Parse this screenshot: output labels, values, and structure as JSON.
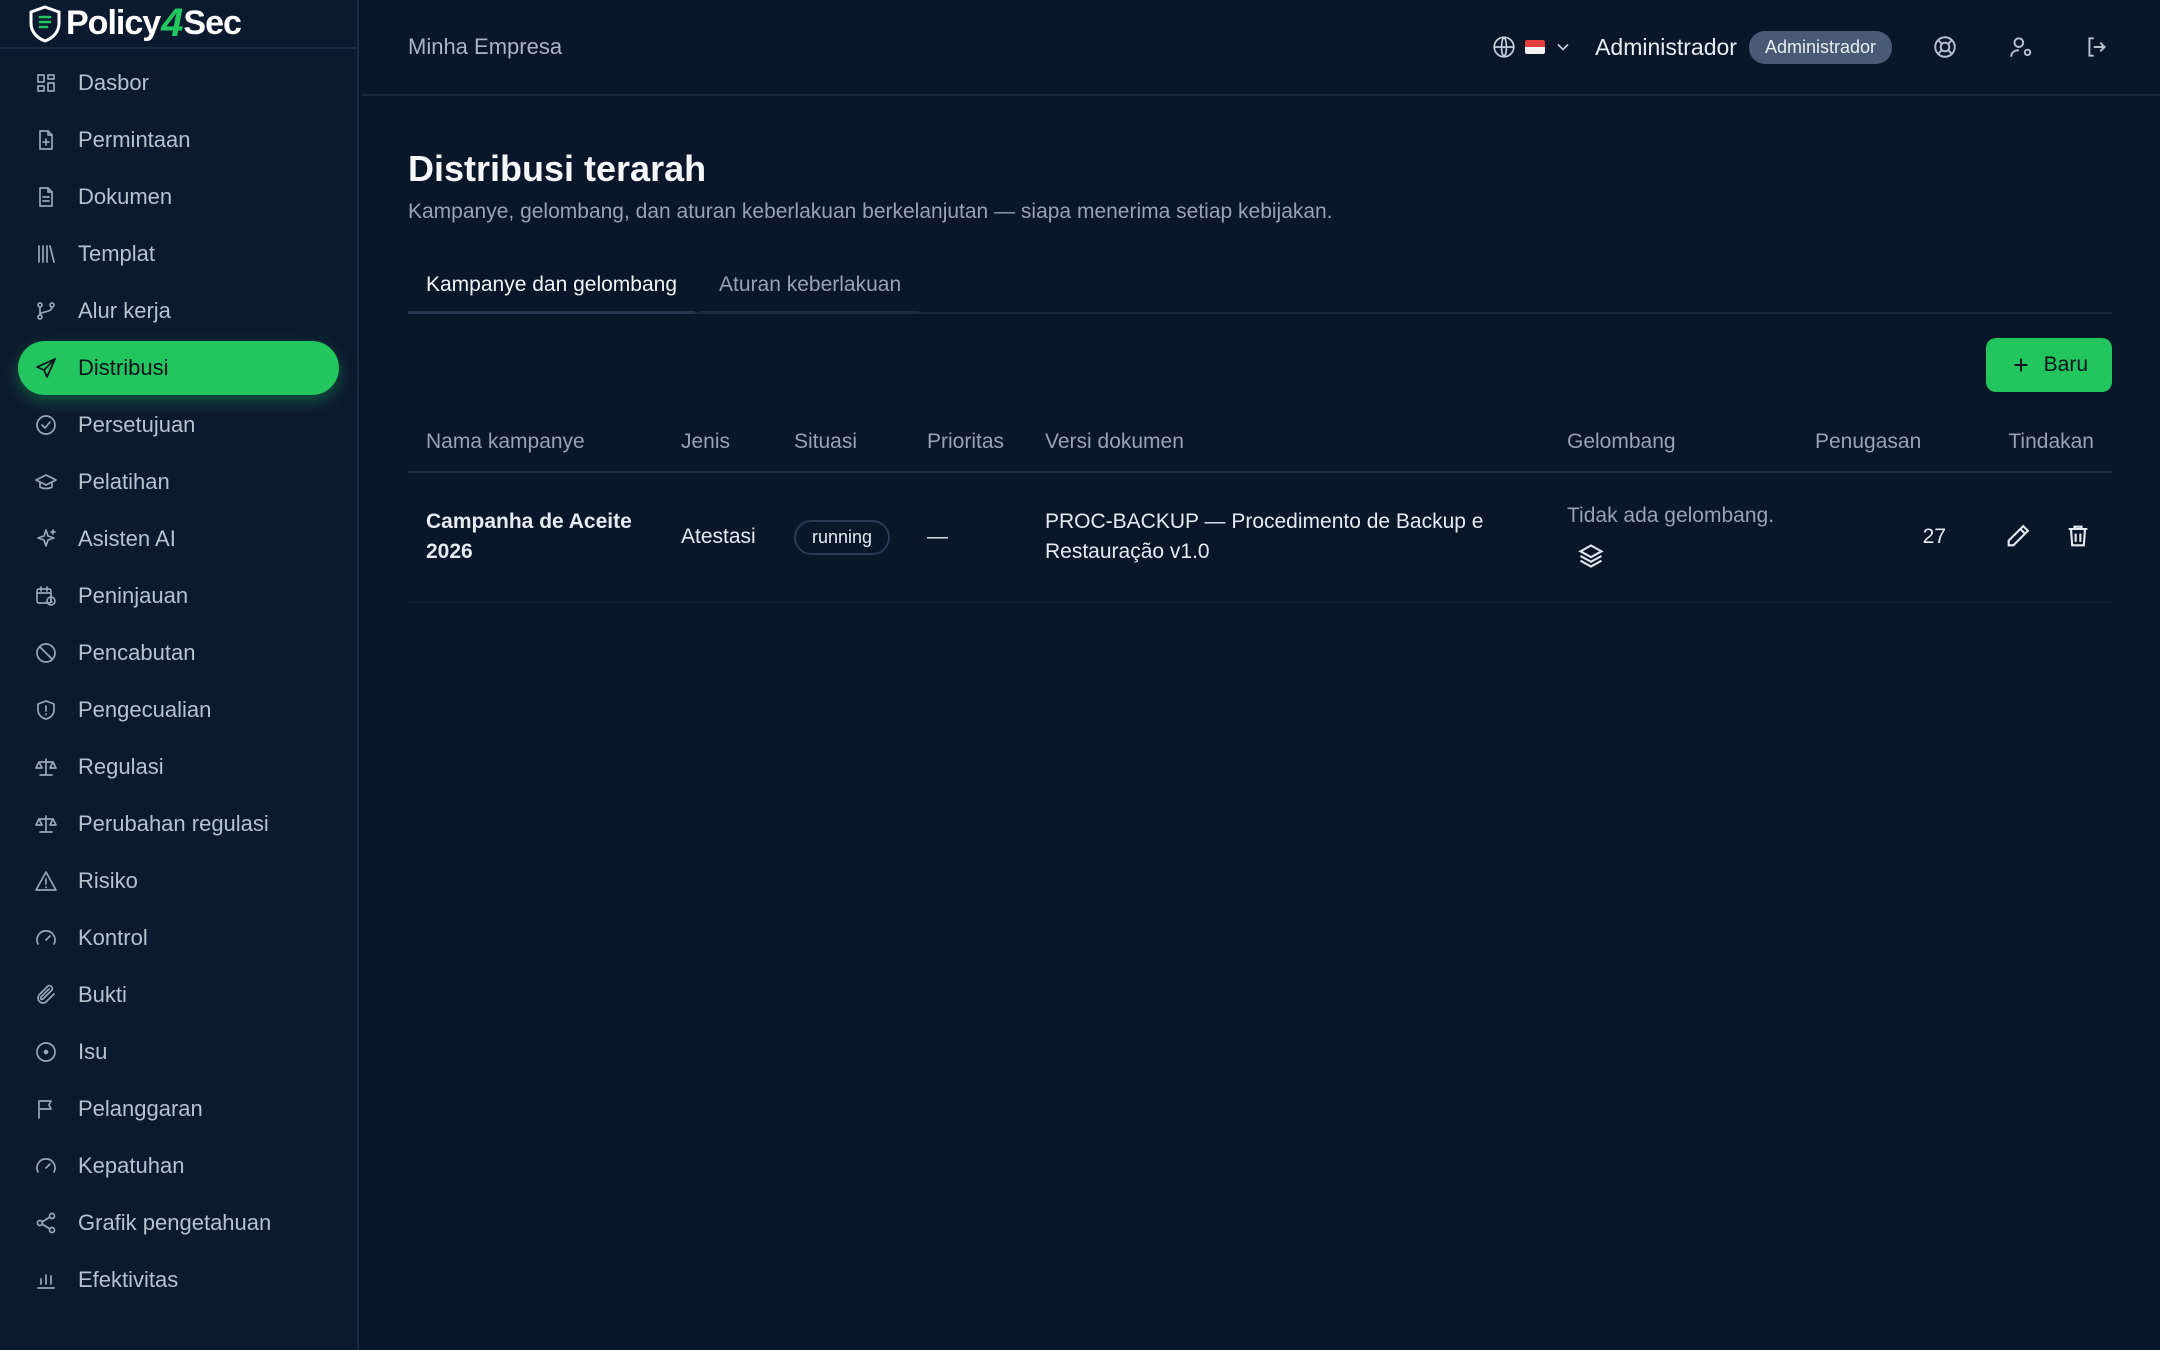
{
  "app": {
    "logo_left": "Policy",
    "logo_four": "4",
    "logo_right": "Sec"
  },
  "sidebar": {
    "items": [
      {
        "label": "Dasbor",
        "icon": "grid-icon"
      },
      {
        "label": "Permintaan",
        "icon": "file-plus-icon"
      },
      {
        "label": "Dokumen",
        "icon": "document-icon"
      },
      {
        "label": "Templat",
        "icon": "library-icon"
      },
      {
        "label": "Alur kerja",
        "icon": "git-branch-icon"
      },
      {
        "label": "Distribusi",
        "icon": "send-icon",
        "active": true
      },
      {
        "label": "Persetujuan",
        "icon": "check-circle-icon"
      },
      {
        "label": "Pelatihan",
        "icon": "graduation-cap-icon"
      },
      {
        "label": "Asisten AI",
        "icon": "sparkles-icon"
      },
      {
        "label": "Peninjauan",
        "icon": "calendar-clock-icon"
      },
      {
        "label": "Pencabutan",
        "icon": "ban-icon"
      },
      {
        "label": "Pengecualian",
        "icon": "shield-alert-icon"
      },
      {
        "label": "Regulasi",
        "icon": "scale-icon"
      },
      {
        "label": "Perubahan regulasi",
        "icon": "scale-icon"
      },
      {
        "label": "Risiko",
        "icon": "warning-triangle-icon"
      },
      {
        "label": "Kontrol",
        "icon": "gauge-icon"
      },
      {
        "label": "Bukti",
        "icon": "paperclip-icon"
      },
      {
        "label": "Isu",
        "icon": "dot-circle-icon"
      },
      {
        "label": "Pelanggaran",
        "icon": "flag-icon"
      },
      {
        "label": "Kepatuhan",
        "icon": "gauge-icon"
      },
      {
        "label": "Grafik pengetahuan",
        "icon": "share-icon"
      },
      {
        "label": "Efektivitas",
        "icon": "chart-icon"
      }
    ]
  },
  "header": {
    "org_name": "Minha Empresa",
    "user_name": "Administrador",
    "role_badge": "Administrador"
  },
  "main": {
    "title": "Distribusi terarah",
    "subtitle": "Kampanye, gelombang, dan aturan keberlakuan berkelanjutan — siapa menerima setiap kebijakan.",
    "tabs": [
      {
        "label": "Kampanye dan gelombang",
        "active": true
      },
      {
        "label": "Aturan keberlakuan",
        "active": false
      }
    ],
    "new_button": "Baru",
    "table": {
      "columns": [
        "Nama kampanye",
        "Jenis",
        "Situasi",
        "Prioritas",
        "Versi dokumen",
        "Gelombang",
        "Penugasan",
        "Tindakan"
      ],
      "rows": [
        {
          "name": "Campanha de Aceite 2026",
          "type": "Atestasi",
          "status": "running",
          "priority": "—",
          "doc_version": "PROC-BACKUP — Procedimento de Backup e Restauração v1.0",
          "waves": "Tidak ada gelombang.",
          "assignments": "27"
        }
      ]
    }
  },
  "colors": {
    "accent": "#22c55e",
    "background": "#0a1629",
    "sidebar": "#0c1a2f",
    "badge": "#4b5a74"
  }
}
